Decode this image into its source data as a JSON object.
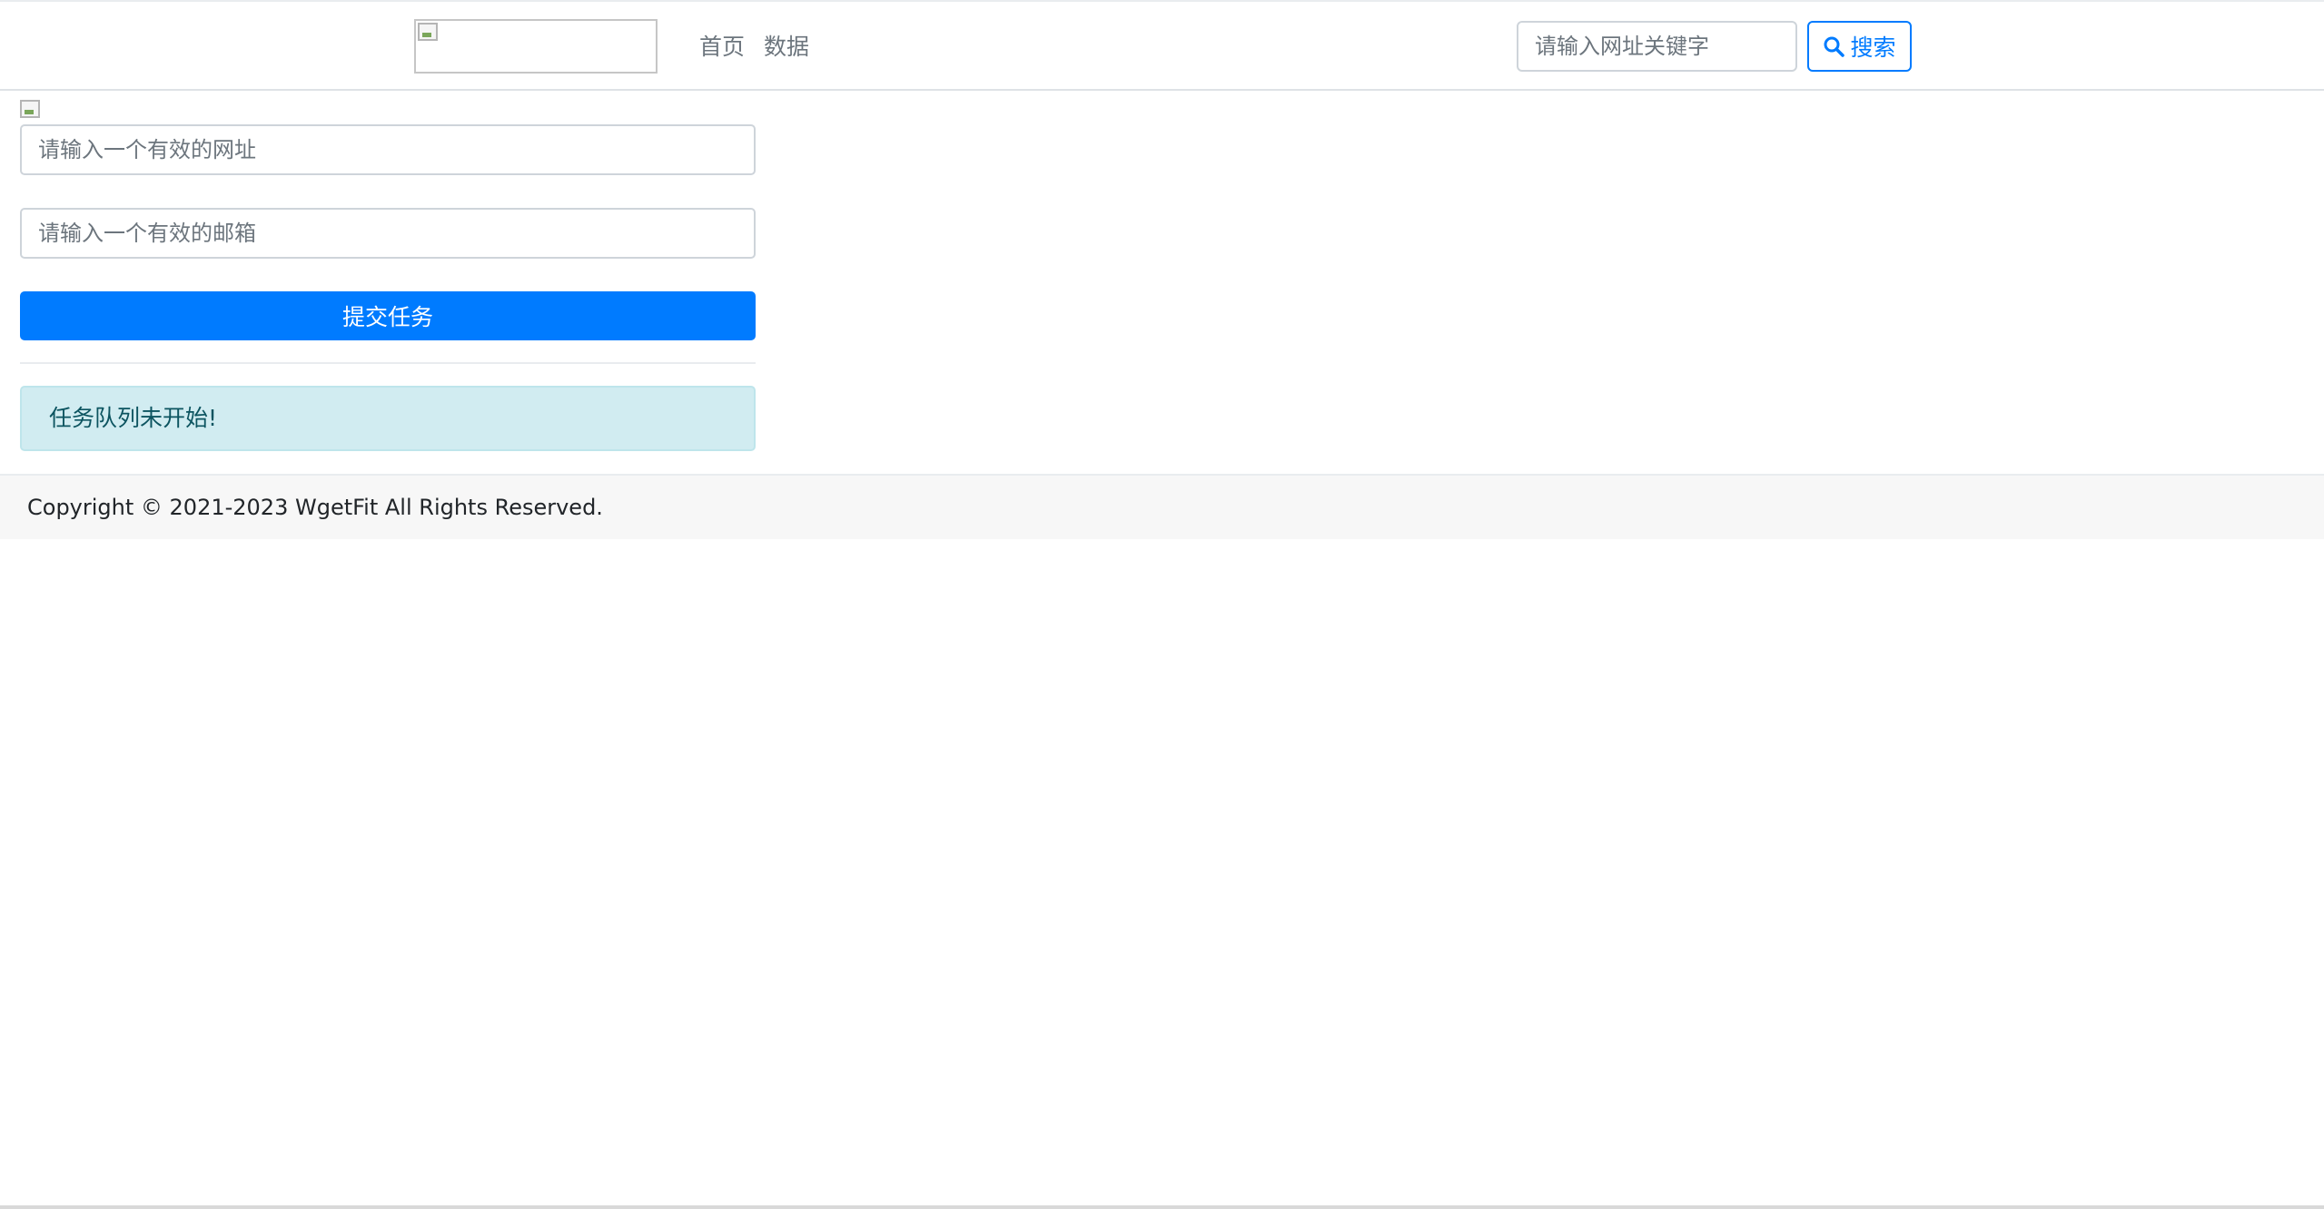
{
  "header": {
    "nav": [
      {
        "label": "首页"
      },
      {
        "label": "数据"
      }
    ],
    "search": {
      "placeholder": "请输入网址关键字",
      "value": "",
      "button_label": "搜索",
      "button_icon": "search-icon"
    }
  },
  "form": {
    "url_placeholder": "请输入一个有效的网址",
    "url_value": "",
    "email_placeholder": "请输入一个有效的邮箱",
    "email_value": "",
    "submit_label": "提交任务"
  },
  "status": {
    "message": "任务队列未开始!"
  },
  "footer": {
    "copyright": "Copyright © 2021-2023 WgetFit All Rights Reserved."
  },
  "colors": {
    "primary": "#007bff",
    "alert_bg": "#d1ecf1",
    "alert_text": "#0c5460",
    "footer_bg": "#f7f7f7"
  }
}
